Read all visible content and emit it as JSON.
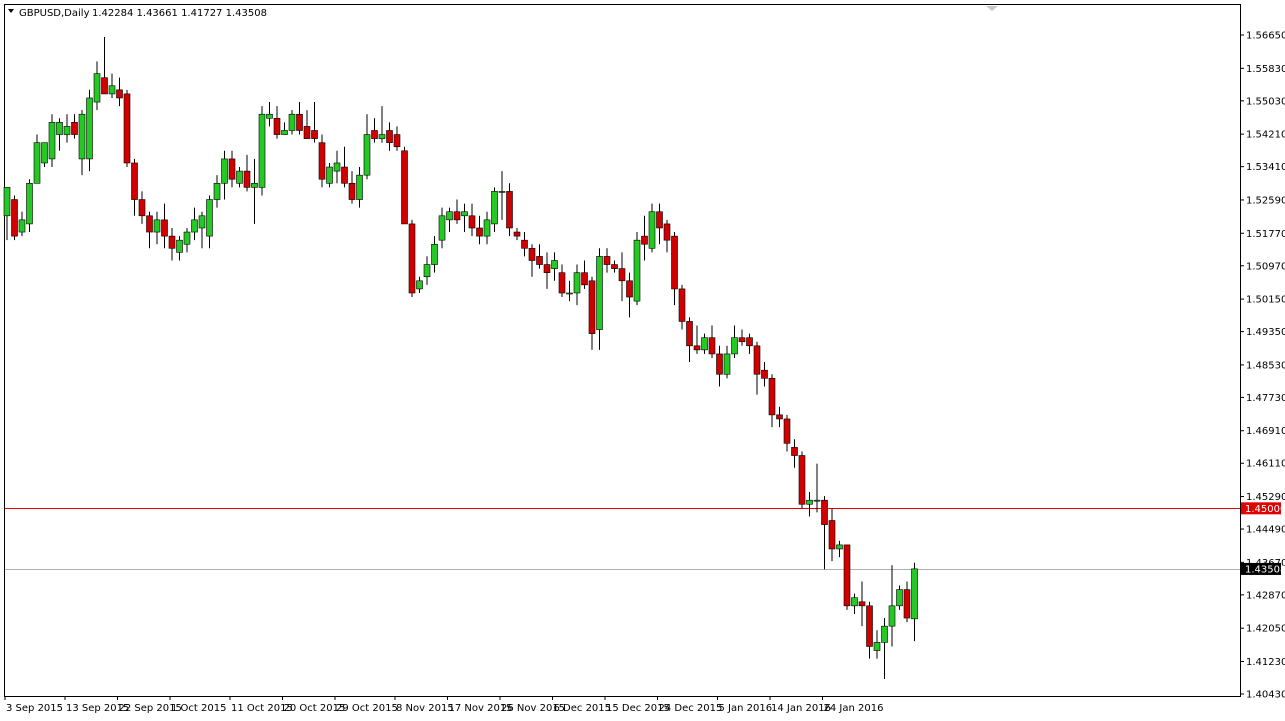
{
  "header": {
    "menu_icon": "triangle-down-icon",
    "symbol": "GBPUSD,Daily",
    "ohlc": "1.42284 1.43661 1.41727 1.43508"
  },
  "colors": {
    "bull": "#26c826",
    "bear": "#d00000",
    "hline_level": "#e00000",
    "hline_current": "#b0b0b0",
    "tag_current": "#000000",
    "frame": "#000000"
  },
  "chart_data": {
    "type": "candlestick",
    "symbol": "GBPUSD",
    "timeframe": "Daily",
    "ylim": [
      1.4043,
      1.5686
    ],
    "y_ticks": [
      "1.56650",
      "1.55830",
      "1.55030",
      "1.54210",
      "1.53410",
      "1.52590",
      "1.51770",
      "1.50970",
      "1.50150",
      "1.49350",
      "1.48530",
      "1.47730",
      "1.46910",
      "1.46110",
      "1.45290",
      "1.44490",
      "1.43670",
      "1.42870",
      "1.42050",
      "1.41230",
      "1.40430"
    ],
    "x_ticks": [
      {
        "label": "3 Sep 2015",
        "index": 0
      },
      {
        "label": "13 Sep 2015",
        "index": 8
      },
      {
        "label": "22 Sep 2015",
        "index": 15
      },
      {
        "label": "1 Oct 2015",
        "index": 22
      },
      {
        "label": "11 Oct 2015",
        "index": 30
      },
      {
        "label": "20 Oct 2015",
        "index": 37
      },
      {
        "label": "29 Oct 2015",
        "index": 44
      },
      {
        "label": "8 Nov 2015",
        "index": 52
      },
      {
        "label": "17 Nov 2015",
        "index": 59
      },
      {
        "label": "26 Nov 2015",
        "index": 66
      },
      {
        "label": "6 Dec 2015",
        "index": 73
      },
      {
        "label": "15 Dec 2015",
        "index": 80
      },
      {
        "label": "24 Dec 2015",
        "index": 87
      },
      {
        "label": "5 Jan 2016",
        "index": 95
      },
      {
        "label": "14 Jan 2016",
        "index": 102
      },
      {
        "label": "24 Jan 2016",
        "index": 109
      }
    ],
    "horizontal_lines": [
      {
        "price": 1.45,
        "label": "1.45000",
        "role": "level"
      },
      {
        "price": 1.43508,
        "label": "1.43508",
        "role": "current"
      }
    ],
    "candles": [
      {
        "o": 1.522,
        "h": 1.529,
        "l": 1.516,
        "c": 1.529
      },
      {
        "o": 1.526,
        "h": 1.527,
        "l": 1.516,
        "c": 1.517
      },
      {
        "o": 1.518,
        "h": 1.523,
        "l": 1.517,
        "c": 1.521
      },
      {
        "o": 1.52,
        "h": 1.531,
        "l": 1.518,
        "c": 1.53
      },
      {
        "o": 1.53,
        "h": 1.542,
        "l": 1.53,
        "c": 1.54
      },
      {
        "o": 1.535,
        "h": 1.54,
        "l": 1.534,
        "c": 1.54
      },
      {
        "o": 1.536,
        "h": 1.547,
        "l": 1.534,
        "c": 1.545
      },
      {
        "o": 1.542,
        "h": 1.546,
        "l": 1.538,
        "c": 1.545
      },
      {
        "o": 1.542,
        "h": 1.547,
        "l": 1.54,
        "c": 1.544
      },
      {
        "o": 1.545,
        "h": 1.547,
        "l": 1.541,
        "c": 1.542
      },
      {
        "o": 1.536,
        "h": 1.548,
        "l": 1.532,
        "c": 1.547
      },
      {
        "o": 1.536,
        "h": 1.553,
        "l": 1.533,
        "c": 1.551
      },
      {
        "o": 1.55,
        "h": 1.56,
        "l": 1.548,
        "c": 1.557
      },
      {
        "o": 1.556,
        "h": 1.566,
        "l": 1.552,
        "c": 1.552
      },
      {
        "o": 1.552,
        "h": 1.557,
        "l": 1.551,
        "c": 1.554
      },
      {
        "o": 1.553,
        "h": 1.556,
        "l": 1.549,
        "c": 1.551
      },
      {
        "o": 1.552,
        "h": 1.553,
        "l": 1.534,
        "c": 1.535
      },
      {
        "o": 1.535,
        "h": 1.536,
        "l": 1.522,
        "c": 1.526
      },
      {
        "o": 1.526,
        "h": 1.528,
        "l": 1.52,
        "c": 1.522
      },
      {
        "o": 1.522,
        "h": 1.523,
        "l": 1.514,
        "c": 1.518
      },
      {
        "o": 1.518,
        "h": 1.523,
        "l": 1.515,
        "c": 1.521
      },
      {
        "o": 1.521,
        "h": 1.525,
        "l": 1.514,
        "c": 1.517
      },
      {
        "o": 1.517,
        "h": 1.519,
        "l": 1.511,
        "c": 1.514
      },
      {
        "o": 1.513,
        "h": 1.517,
        "l": 1.511,
        "c": 1.516
      },
      {
        "o": 1.515,
        "h": 1.519,
        "l": 1.513,
        "c": 1.518
      },
      {
        "o": 1.518,
        "h": 1.524,
        "l": 1.516,
        "c": 1.521
      },
      {
        "o": 1.519,
        "h": 1.523,
        "l": 1.514,
        "c": 1.522
      },
      {
        "o": 1.517,
        "h": 1.527,
        "l": 1.514,
        "c": 1.526
      },
      {
        "o": 1.526,
        "h": 1.532,
        "l": 1.524,
        "c": 1.53
      },
      {
        "o": 1.53,
        "h": 1.538,
        "l": 1.526,
        "c": 1.536
      },
      {
        "o": 1.536,
        "h": 1.538,
        "l": 1.529,
        "c": 1.531
      },
      {
        "o": 1.53,
        "h": 1.534,
        "l": 1.529,
        "c": 1.533
      },
      {
        "o": 1.533,
        "h": 1.537,
        "l": 1.528,
        "c": 1.529
      },
      {
        "o": 1.529,
        "h": 1.536,
        "l": 1.52,
        "c": 1.53
      },
      {
        "o": 1.529,
        "h": 1.549,
        "l": 1.527,
        "c": 1.547
      },
      {
        "o": 1.546,
        "h": 1.55,
        "l": 1.544,
        "c": 1.547
      },
      {
        "o": 1.546,
        "h": 1.549,
        "l": 1.541,
        "c": 1.542
      },
      {
        "o": 1.542,
        "h": 1.545,
        "l": 1.542,
        "c": 1.543
      },
      {
        "o": 1.543,
        "h": 1.548,
        "l": 1.542,
        "c": 1.547
      },
      {
        "o": 1.547,
        "h": 1.55,
        "l": 1.542,
        "c": 1.543
      },
      {
        "o": 1.544,
        "h": 1.548,
        "l": 1.541,
        "c": 1.541
      },
      {
        "o": 1.543,
        "h": 1.55,
        "l": 1.54,
        "c": 1.541
      },
      {
        "o": 1.54,
        "h": 1.542,
        "l": 1.529,
        "c": 1.531
      },
      {
        "o": 1.53,
        "h": 1.535,
        "l": 1.529,
        "c": 1.534
      },
      {
        "o": 1.533,
        "h": 1.538,
        "l": 1.53,
        "c": 1.535
      },
      {
        "o": 1.534,
        "h": 1.539,
        "l": 1.529,
        "c": 1.53
      },
      {
        "o": 1.53,
        "h": 1.533,
        "l": 1.525,
        "c": 1.526
      },
      {
        "o": 1.526,
        "h": 1.534,
        "l": 1.524,
        "c": 1.532
      },
      {
        "o": 1.532,
        "h": 1.547,
        "l": 1.531,
        "c": 1.542
      },
      {
        "o": 1.543,
        "h": 1.546,
        "l": 1.54,
        "c": 1.541
      },
      {
        "o": 1.541,
        "h": 1.549,
        "l": 1.54,
        "c": 1.542
      },
      {
        "o": 1.543,
        "h": 1.545,
        "l": 1.538,
        "c": 1.54
      },
      {
        "o": 1.542,
        "h": 1.544,
        "l": 1.538,
        "c": 1.539
      },
      {
        "o": 1.538,
        "h": 1.539,
        "l": 1.52,
        "c": 1.52
      },
      {
        "o": 1.52,
        "h": 1.521,
        "l": 1.502,
        "c": 1.503
      },
      {
        "o": 1.504,
        "h": 1.507,
        "l": 1.503,
        "c": 1.506
      },
      {
        "o": 1.507,
        "h": 1.512,
        "l": 1.505,
        "c": 1.51
      },
      {
        "o": 1.51,
        "h": 1.517,
        "l": 1.508,
        "c": 1.515
      },
      {
        "o": 1.516,
        "h": 1.524,
        "l": 1.514,
        "c": 1.522
      },
      {
        "o": 1.521,
        "h": 1.524,
        "l": 1.518,
        "c": 1.523
      },
      {
        "o": 1.523,
        "h": 1.526,
        "l": 1.52,
        "c": 1.521
      },
      {
        "o": 1.522,
        "h": 1.525,
        "l": 1.518,
        "c": 1.523
      },
      {
        "o": 1.522,
        "h": 1.525,
        "l": 1.517,
        "c": 1.519
      },
      {
        "o": 1.519,
        "h": 1.522,
        "l": 1.515,
        "c": 1.517
      },
      {
        "o": 1.517,
        "h": 1.523,
        "l": 1.515,
        "c": 1.521
      },
      {
        "o": 1.52,
        "h": 1.529,
        "l": 1.518,
        "c": 1.528
      },
      {
        "o": 1.528,
        "h": 1.533,
        "l": 1.521,
        "c": 1.528
      },
      {
        "o": 1.528,
        "h": 1.53,
        "l": 1.517,
        "c": 1.519
      },
      {
        "o": 1.518,
        "h": 1.519,
        "l": 1.516,
        "c": 1.517
      },
      {
        "o": 1.516,
        "h": 1.518,
        "l": 1.512,
        "c": 1.514
      },
      {
        "o": 1.514,
        "h": 1.515,
        "l": 1.507,
        "c": 1.511
      },
      {
        "o": 1.512,
        "h": 1.515,
        "l": 1.509,
        "c": 1.51
      },
      {
        "o": 1.51,
        "h": 1.513,
        "l": 1.504,
        "c": 1.508
      },
      {
        "o": 1.509,
        "h": 1.513,
        "l": 1.506,
        "c": 1.511
      },
      {
        "o": 1.508,
        "h": 1.51,
        "l": 1.502,
        "c": 1.503
      },
      {
        "o": 1.503,
        "h": 1.506,
        "l": 1.501,
        "c": 1.503
      },
      {
        "o": 1.503,
        "h": 1.51,
        "l": 1.5,
        "c": 1.508
      },
      {
        "o": 1.508,
        "h": 1.511,
        "l": 1.504,
        "c": 1.505
      },
      {
        "o": 1.506,
        "h": 1.507,
        "l": 1.489,
        "c": 1.493
      },
      {
        "o": 1.494,
        "h": 1.514,
        "l": 1.489,
        "c": 1.512
      },
      {
        "o": 1.512,
        "h": 1.514,
        "l": 1.508,
        "c": 1.51
      },
      {
        "o": 1.51,
        "h": 1.511,
        "l": 1.508,
        "c": 1.509
      },
      {
        "o": 1.509,
        "h": 1.513,
        "l": 1.501,
        "c": 1.506
      },
      {
        "o": 1.506,
        "h": 1.508,
        "l": 1.497,
        "c": 1.502
      },
      {
        "o": 1.501,
        "h": 1.518,
        "l": 1.5,
        "c": 1.516
      },
      {
        "o": 1.517,
        "h": 1.522,
        "l": 1.511,
        "c": 1.515
      },
      {
        "o": 1.514,
        "h": 1.525,
        "l": 1.513,
        "c": 1.523
      },
      {
        "o": 1.523,
        "h": 1.525,
        "l": 1.515,
        "c": 1.519
      },
      {
        "o": 1.52,
        "h": 1.521,
        "l": 1.513,
        "c": 1.516
      },
      {
        "o": 1.517,
        "h": 1.518,
        "l": 1.5,
        "c": 1.504
      },
      {
        "o": 1.504,
        "h": 1.505,
        "l": 1.494,
        "c": 1.496
      },
      {
        "o": 1.496,
        "h": 1.497,
        "l": 1.486,
        "c": 1.49
      },
      {
        "o": 1.49,
        "h": 1.495,
        "l": 1.488,
        "c": 1.489
      },
      {
        "o": 1.489,
        "h": 1.493,
        "l": 1.488,
        "c": 1.492
      },
      {
        "o": 1.492,
        "h": 1.495,
        "l": 1.487,
        "c": 1.488
      },
      {
        "o": 1.488,
        "h": 1.49,
        "l": 1.48,
        "c": 1.483
      },
      {
        "o": 1.483,
        "h": 1.49,
        "l": 1.482,
        "c": 1.488
      },
      {
        "o": 1.488,
        "h": 1.495,
        "l": 1.487,
        "c": 1.492
      },
      {
        "o": 1.492,
        "h": 1.494,
        "l": 1.49,
        "c": 1.491
      },
      {
        "o": 1.492,
        "h": 1.493,
        "l": 1.488,
        "c": 1.49
      },
      {
        "o": 1.49,
        "h": 1.491,
        "l": 1.478,
        "c": 1.483
      },
      {
        "o": 1.484,
        "h": 1.486,
        "l": 1.48,
        "c": 1.482
      },
      {
        "o": 1.482,
        "h": 1.483,
        "l": 1.47,
        "c": 1.473
      },
      {
        "o": 1.473,
        "h": 1.475,
        "l": 1.47,
        "c": 1.472
      },
      {
        "o": 1.472,
        "h": 1.473,
        "l": 1.464,
        "c": 1.466
      },
      {
        "o": 1.465,
        "h": 1.467,
        "l": 1.46,
        "c": 1.463
      },
      {
        "o": 1.463,
        "h": 1.464,
        "l": 1.45,
        "c": 1.451
      },
      {
        "o": 1.451,
        "h": 1.454,
        "l": 1.448,
        "c": 1.452
      },
      {
        "o": 1.452,
        "h": 1.461,
        "l": 1.449,
        "c": 1.452
      },
      {
        "o": 1.452,
        "h": 1.453,
        "l": 1.435,
        "c": 1.446
      },
      {
        "o": 1.447,
        "h": 1.45,
        "l": 1.437,
        "c": 1.44
      },
      {
        "o": 1.44,
        "h": 1.442,
        "l": 1.438,
        "c": 1.441
      },
      {
        "o": 1.441,
        "h": 1.441,
        "l": 1.425,
        "c": 1.426
      },
      {
        "o": 1.426,
        "h": 1.429,
        "l": 1.424,
        "c": 1.428
      },
      {
        "o": 1.427,
        "h": 1.432,
        "l": 1.421,
        "c": 1.426
      },
      {
        "o": 1.426,
        "h": 1.427,
        "l": 1.413,
        "c": 1.416
      },
      {
        "o": 1.415,
        "h": 1.42,
        "l": 1.413,
        "c": 1.417
      },
      {
        "o": 1.417,
        "h": 1.423,
        "l": 1.408,
        "c": 1.421
      },
      {
        "o": 1.421,
        "h": 1.436,
        "l": 1.416,
        "c": 1.426
      },
      {
        "o": 1.426,
        "h": 1.431,
        "l": 1.425,
        "c": 1.43
      },
      {
        "o": 1.43,
        "h": 1.432,
        "l": 1.422,
        "c": 1.423
      },
      {
        "o": 1.4228,
        "h": 1.4366,
        "l": 1.4173,
        "c": 1.4351
      }
    ]
  }
}
